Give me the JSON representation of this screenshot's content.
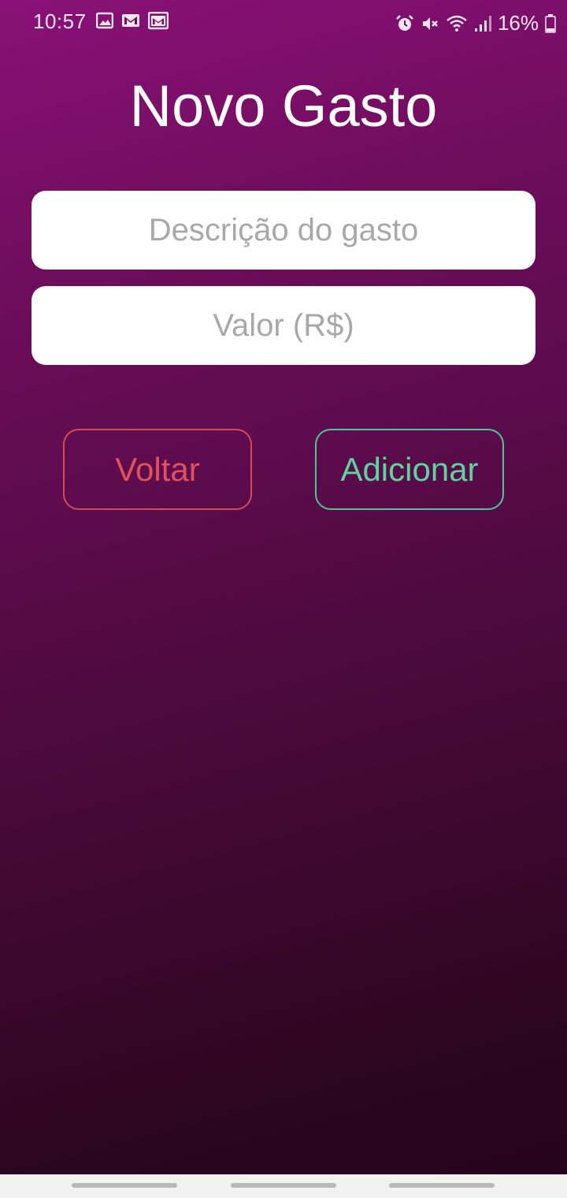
{
  "status_bar": {
    "time": "10:57",
    "left_icons": [
      "image-icon",
      "gmail-icon",
      "gmail-stack-icon"
    ],
    "right_icons": [
      "alarm-icon",
      "mute-icon",
      "wifi-icon",
      "signal-icon"
    ],
    "battery": "16%"
  },
  "page": {
    "title": "Novo Gasto"
  },
  "form": {
    "description_placeholder": "Descrição do gasto",
    "description_value": "",
    "value_placeholder": "Valor (R$)",
    "value_value": ""
  },
  "actions": {
    "back_label": "Voltar",
    "add_label": "Adicionar"
  },
  "colors": {
    "background_top": "#8a1178",
    "background_bottom": "#24041a",
    "back_accent": "#e0525a",
    "add_accent": "#5fd39e"
  }
}
